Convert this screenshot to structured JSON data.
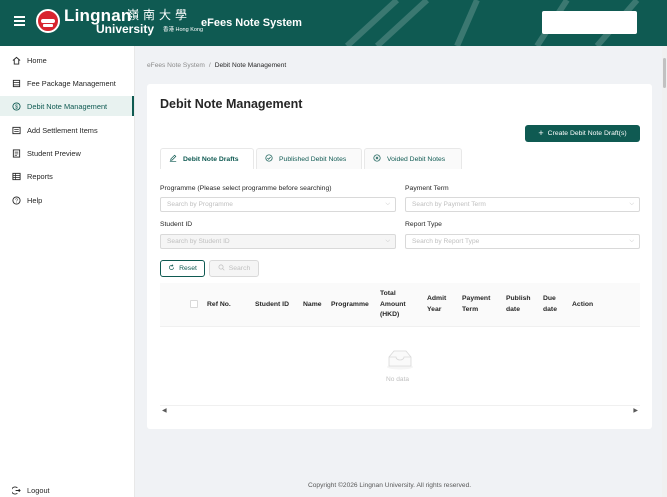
{
  "header": {
    "logo_name": "Lingnan",
    "logo_university": "University",
    "logo_chinese": "嶺南大學",
    "logo_hongkong": "香港 Hong Kong",
    "app_title": "eFees Note System",
    "brand_color": "#0f5a52"
  },
  "sidebar": {
    "items": [
      {
        "label": "Home",
        "icon": "home-icon"
      },
      {
        "label": "Fee Package Management",
        "icon": "package-icon"
      },
      {
        "label": "Debit Note Management",
        "icon": "dollar-circle-icon",
        "active": true
      },
      {
        "label": "Add Settlement Items",
        "icon": "list-icon"
      },
      {
        "label": "Student Preview",
        "icon": "document-icon"
      },
      {
        "label": "Reports",
        "icon": "table-icon"
      },
      {
        "label": "Help",
        "icon": "question-icon"
      }
    ],
    "logout_label": "Logout"
  },
  "breadcrumb": {
    "root": "eFees Note System",
    "separator": "/",
    "current": "Debit Note Management"
  },
  "main": {
    "title": "Debit Note Management",
    "create_button": "Create Debit Note Draft(s)",
    "tabs": [
      {
        "label": "Debit Note Drafts",
        "icon": "edit-icon",
        "active": true
      },
      {
        "label": "Published Debit Notes",
        "icon": "check-circle-icon"
      },
      {
        "label": "Voided Debit Notes",
        "icon": "close-circle-icon"
      }
    ],
    "filters": {
      "programme_label": "Programme (Please select programme before searching)",
      "programme_placeholder": "Search by Programme",
      "payment_term_label": "Payment Term",
      "payment_term_placeholder": "Search by Payment Term",
      "student_id_label": "Student ID",
      "student_id_placeholder": "Search by Student ID",
      "report_type_label": "Report Type",
      "report_type_placeholder": "Search by Report Type"
    },
    "reset_button": "Reset",
    "search_button": "Search",
    "table": {
      "columns": [
        "Ref No.",
        "Student ID",
        "Name",
        "Programme",
        "Total Amount (HKD)",
        "Admit Year",
        "Payment Term",
        "Publish date",
        "Due date",
        "Action"
      ],
      "empty_text": "No data"
    }
  },
  "footer": {
    "copyright": "Copyright ©2026 Lingnan University. All rights reserved."
  }
}
